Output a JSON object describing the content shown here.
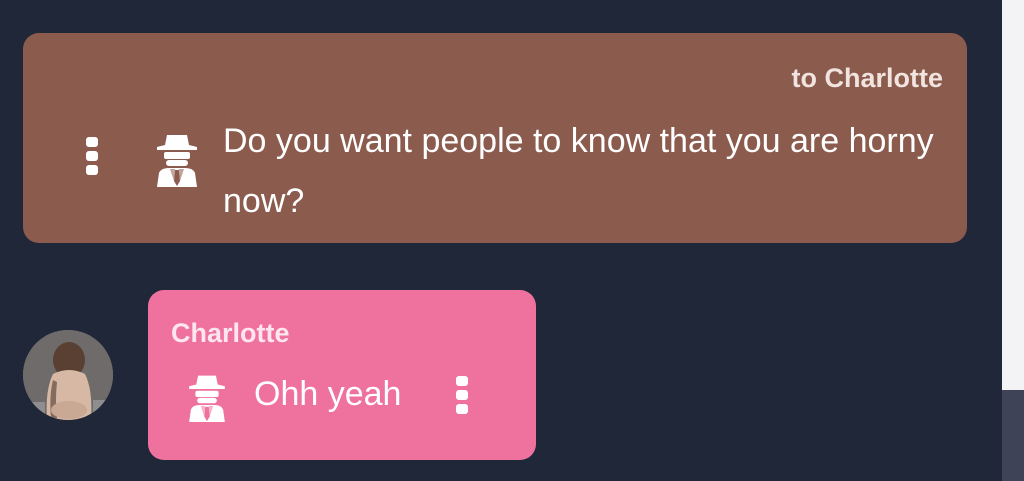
{
  "messages": {
    "outgoing": {
      "recipient_label": "to Charlotte",
      "text": "Do you want people to know that you are horny now?",
      "icon": "spy-icon",
      "color": "#8b5b4e"
    },
    "incoming": {
      "sender": "Charlotte",
      "text": "Ohh yeah",
      "icon": "spy-icon",
      "color": "#ef729e"
    }
  },
  "theme": {
    "background": "#1f2738",
    "scrollbar_thumb": "#3e4358"
  }
}
